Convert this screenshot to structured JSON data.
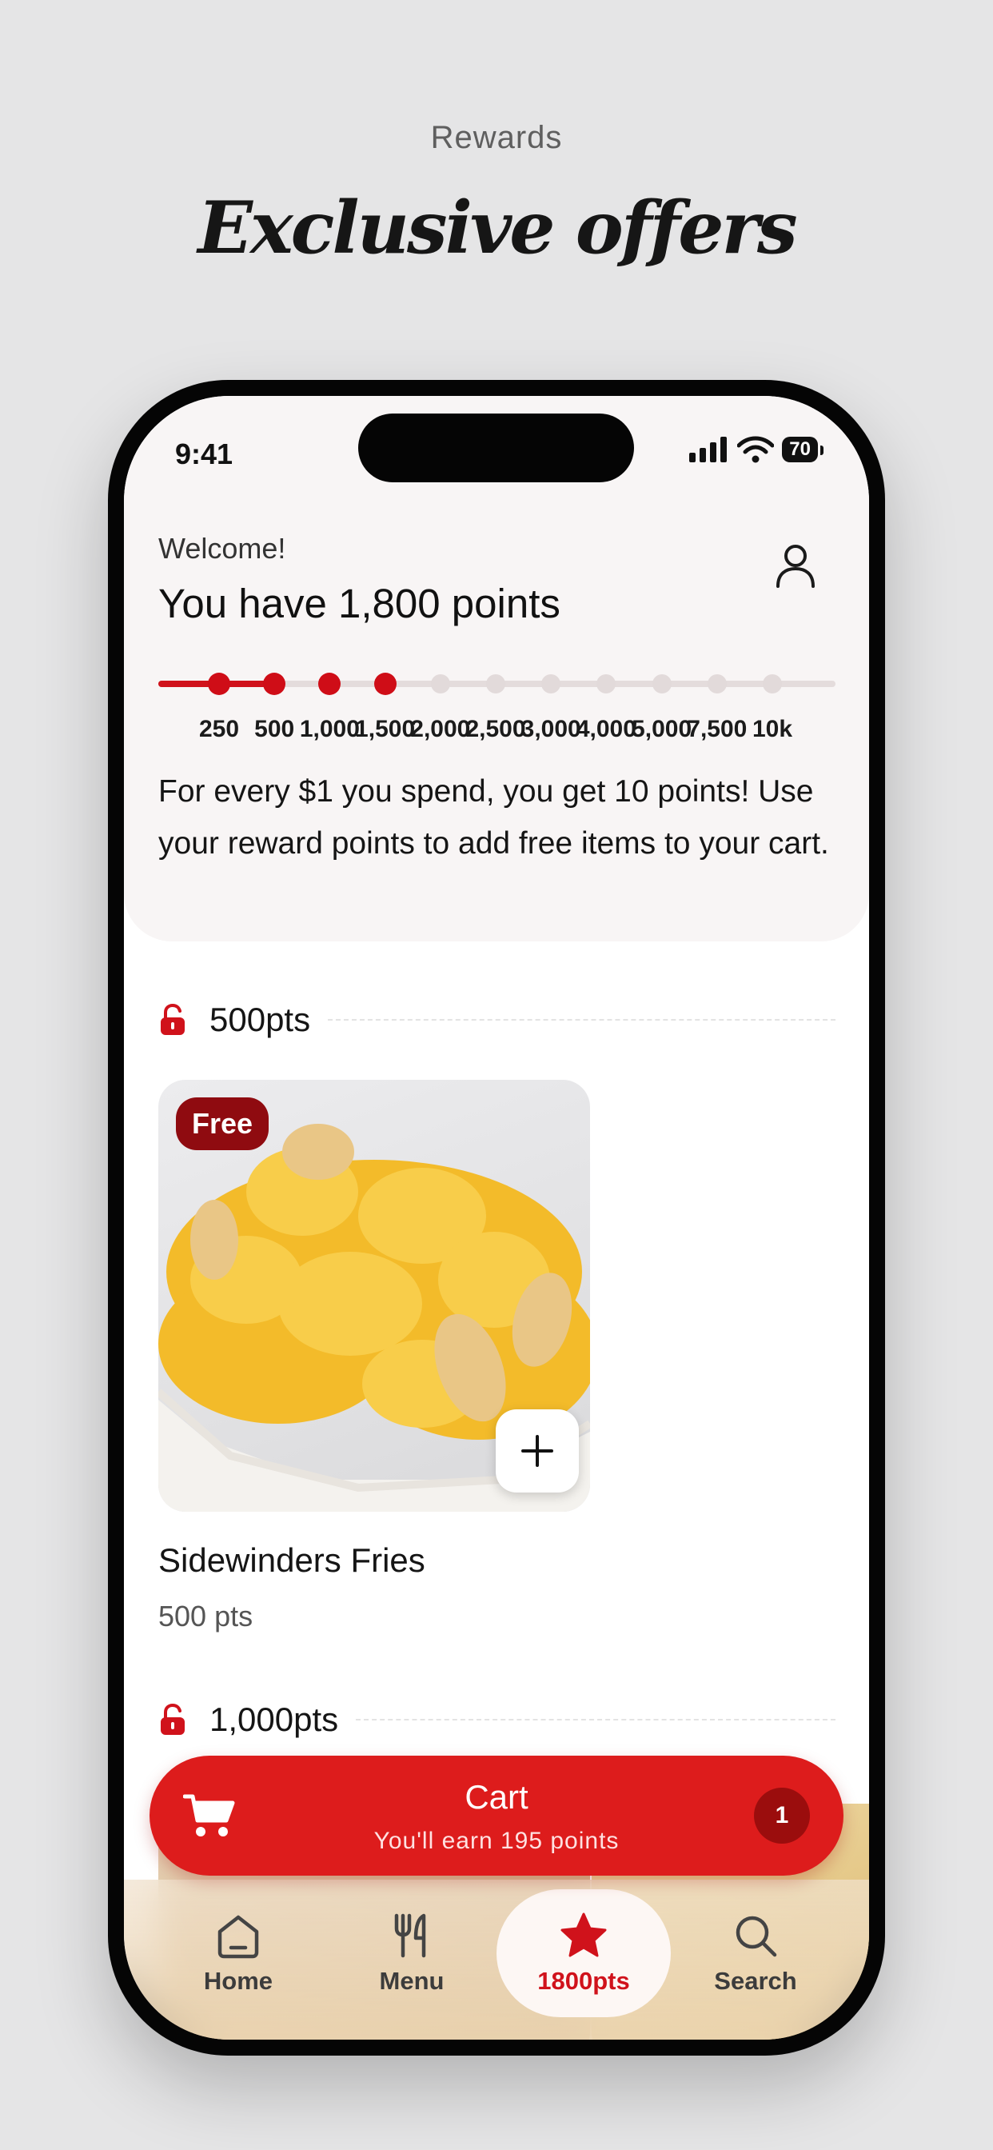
{
  "page": {
    "eyebrow": "Rewards",
    "headline": "Exclusive offers"
  },
  "status_bar": {
    "time": "9:41",
    "battery": "70"
  },
  "header": {
    "welcome": "Welcome!",
    "points_title": "You have 1,800 points",
    "description": "For every $1 you spend, you get 10 points! Use your reward points to add free items to your cart."
  },
  "progress": {
    "current_points": 1800,
    "milestones": [
      "250",
      "500",
      "1,000",
      "1,500",
      "2,000",
      "2,500",
      "3,000",
      "4,000",
      "5,000",
      "7,500",
      "10k"
    ],
    "unlocked_count": 4
  },
  "sections": [
    {
      "label": "500pts"
    },
    {
      "label": "1,000pts"
    }
  ],
  "items": [
    {
      "badge": "Free",
      "name": "Sidewinders Fries",
      "price": "500 pts"
    }
  ],
  "cart": {
    "title": "Cart",
    "subtitle": "You'll earn 195 points",
    "count": "1"
  },
  "tabs": [
    {
      "label": "Home",
      "icon": "home-icon"
    },
    {
      "label": "Menu",
      "icon": "utensils-icon"
    },
    {
      "label": "1800pts",
      "icon": "star-icon",
      "active": true
    },
    {
      "label": "Search",
      "icon": "search-icon"
    }
  ],
  "colors": {
    "accent": "#dd1c1c",
    "dark_red": "#8f0b10",
    "background": "#e5e5e6"
  }
}
